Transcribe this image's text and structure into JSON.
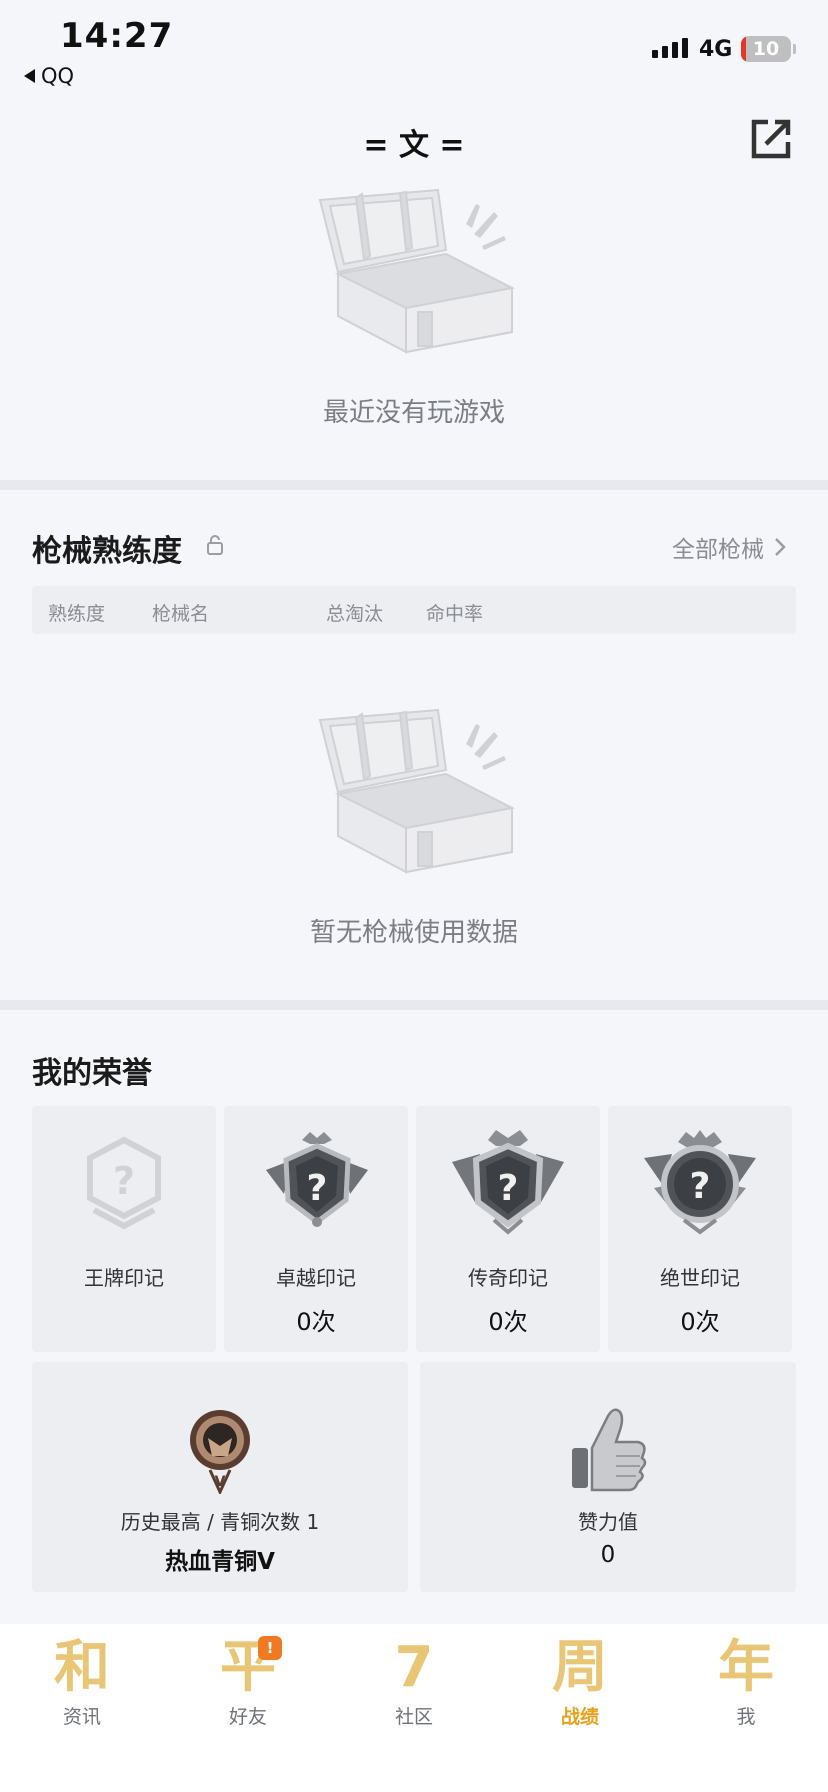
{
  "status_bar": {
    "time": "14:27",
    "back_app": "QQ",
    "network": "4G",
    "battery": "10",
    "battery_level": 0.1
  },
  "header": {
    "player_name": "= 文 =",
    "share_icon": "share-external-icon"
  },
  "recent_games": {
    "empty_text": "最近没有玩游戏",
    "empty_icon": "empty-chest-icon"
  },
  "weapons": {
    "title": "枪械熟练度",
    "lock_icon": "lock-icon",
    "all_link": "全部枪械",
    "columns": [
      "熟练度",
      "枪械名",
      "总淘汰",
      "命中率"
    ],
    "empty_text": "暂无枪械使用数据"
  },
  "honors": {
    "title": "我的荣誉",
    "marks": [
      {
        "label": "王牌印记",
        "count": "",
        "icon": "ace-mark-icon"
      },
      {
        "label": "卓越印记",
        "count": "0次",
        "icon": "excellence-mark-icon"
      },
      {
        "label": "传奇印记",
        "count": "0次",
        "icon": "legend-mark-icon"
      },
      {
        "label": "绝世印记",
        "count": "0次",
        "icon": "peerless-mark-icon"
      }
    ],
    "history": {
      "label": "历史最高 / 青铜次数 1",
      "value": "热血青铜Ⅴ",
      "icon": "bronze-rank-icon"
    },
    "likes": {
      "label": "赞力值",
      "value": "0",
      "icon": "thumbs-up-icon"
    }
  },
  "tab_bar": {
    "tabs": [
      {
        "glyph": "和",
        "label": "资讯",
        "active": false
      },
      {
        "glyph": "平",
        "label": "好友",
        "active": false,
        "badge": "!"
      },
      {
        "glyph": "7",
        "label": "社区",
        "active": false
      },
      {
        "glyph": "周",
        "label": "战绩",
        "active": true
      },
      {
        "glyph": "年",
        "label": "我",
        "active": false
      }
    ]
  },
  "colors": {
    "background": "#f4f6fa",
    "tab_active": "#e6a21c",
    "tab_glyph": "#e8c676",
    "badge": "#f07a22",
    "battery_low": "#e5362b"
  }
}
